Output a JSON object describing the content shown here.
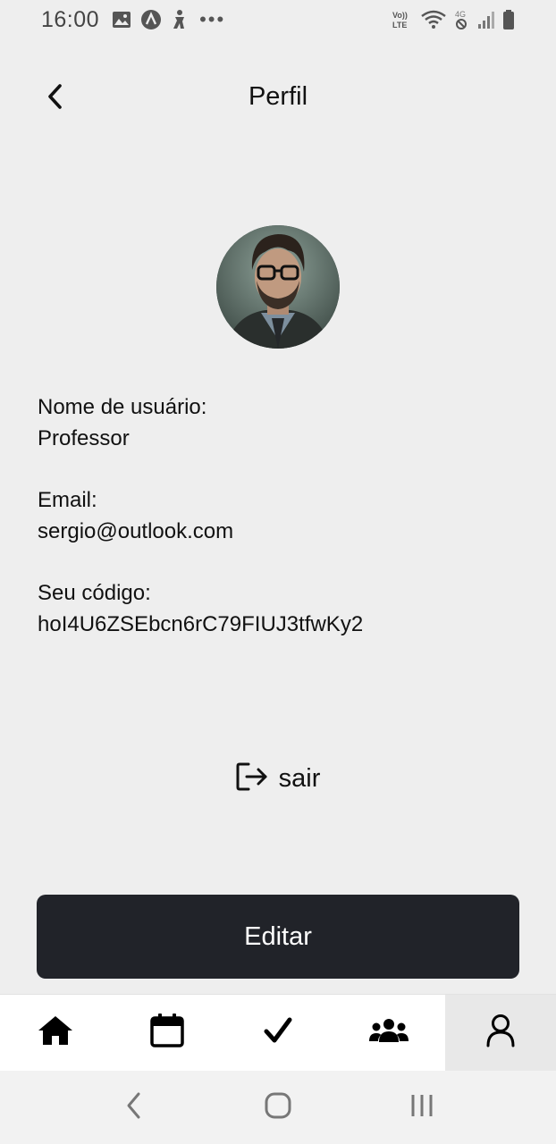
{
  "status_bar": {
    "time": "16:00",
    "dots": "•••",
    "icons_left": [
      "image-icon",
      "app-badge-icon",
      "accessibility-icon"
    ],
    "icons_right": [
      "volte-icon",
      "wifi-icon",
      "4g-signal-icon",
      "signal-bars-icon",
      "battery-icon"
    ],
    "volte_label": "Vo)) LTE",
    "network_label": "4G"
  },
  "header": {
    "title": "Perfil",
    "back_icon": "chevron-left-icon"
  },
  "profile": {
    "username_label": "Nome de usuário:",
    "username_value": "Professor",
    "email_label": "Email:",
    "email_value": "sergio@outlook.com",
    "code_label": "Seu código:",
    "code_value": "hoI4U6ZSEbcn6rC79FIUJ3tfwKy2"
  },
  "logout": {
    "label": "sair",
    "icon": "logout-icon"
  },
  "edit_button": {
    "label": "Editar"
  },
  "tab_bar": {
    "items": [
      {
        "name": "home",
        "icon": "home-icon",
        "active": false
      },
      {
        "name": "calendar",
        "icon": "calendar-icon",
        "active": false
      },
      {
        "name": "tasks",
        "icon": "checkmark-icon",
        "active": false
      },
      {
        "name": "groups",
        "icon": "group-icon",
        "active": false
      },
      {
        "name": "profile",
        "icon": "user-icon",
        "active": true
      }
    ]
  },
  "system_nav": {
    "items": [
      "back-nav-icon",
      "home-nav-icon",
      "recents-nav-icon"
    ]
  },
  "colors": {
    "background": "#eeeeee",
    "button_dark": "#212329",
    "tab_bar_bg": "#ffffff",
    "active_tab_bg": "#e8e8e8",
    "text": "#111111"
  }
}
